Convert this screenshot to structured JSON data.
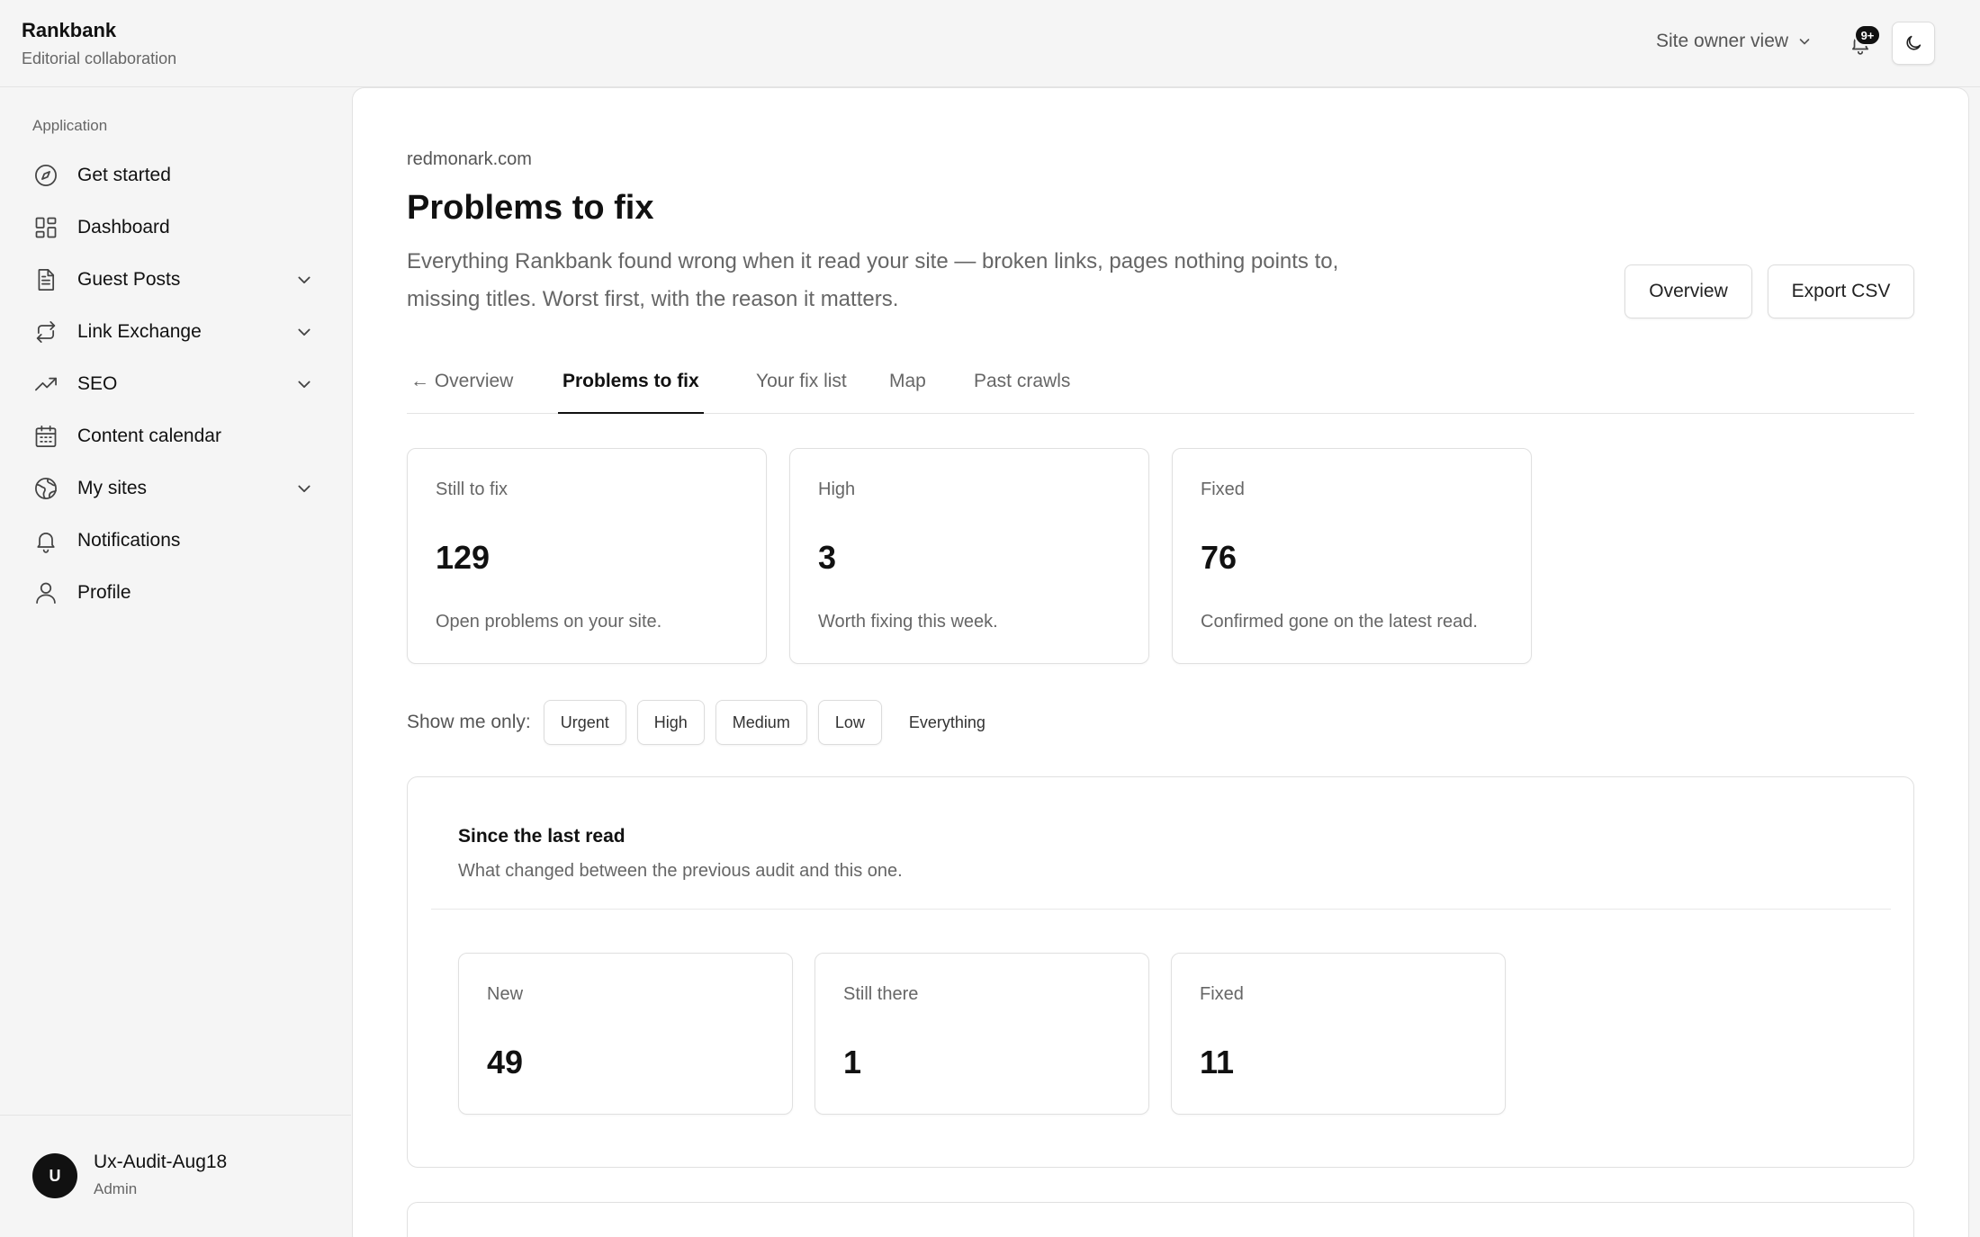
{
  "brand": {
    "name": "Rankbank",
    "subtitle": "Editorial collaboration"
  },
  "header": {
    "view_switch": "Site owner view",
    "notification_badge": "9+",
    "icons": {
      "view_switch": "chevron-down-icon",
      "notifications": "bell-icon",
      "theme": "moon-icon"
    }
  },
  "sidebar": {
    "group_label": "Application",
    "items": [
      {
        "label": "Get started",
        "icon": "compass-icon",
        "expandable": false
      },
      {
        "label": "Dashboard",
        "icon": "dashboard-icon",
        "expandable": false
      },
      {
        "label": "Guest Posts",
        "icon": "document-icon",
        "expandable": true
      },
      {
        "label": "Link Exchange",
        "icon": "exchange-icon",
        "expandable": true
      },
      {
        "label": "SEO",
        "icon": "trending-up-icon",
        "expandable": true
      },
      {
        "label": "Content calendar",
        "icon": "calendar-icon",
        "expandable": false
      },
      {
        "label": "My sites",
        "icon": "globe-icon",
        "expandable": true
      },
      {
        "label": "Notifications",
        "icon": "bell-icon",
        "expandable": false
      },
      {
        "label": "Profile",
        "icon": "user-icon",
        "expandable": false
      }
    ],
    "user": {
      "initial": "U",
      "name": "Ux-Audit-Aug18",
      "role": "Admin"
    }
  },
  "main": {
    "breadcrumb": "redmonark.com",
    "title": "Problems to fix",
    "description": "Everything Rankbank found wrong when it read your site — broken links, pages nothing points to, missing titles. Worst first, with the reason it matters.",
    "actions": {
      "overview": "Overview",
      "export": "Export CSV"
    },
    "tabs": [
      {
        "label": "← Overview",
        "active": false
      },
      {
        "label": "Problems to fix",
        "active": true
      },
      {
        "label": "Your fix list",
        "active": false
      },
      {
        "label": "Map",
        "active": false
      },
      {
        "label": "Past crawls",
        "active": false
      }
    ],
    "stats": [
      {
        "label": "Still to fix",
        "value": "129",
        "note": "Open problems on your site."
      },
      {
        "label": "High",
        "value": "3",
        "note": "Worth fixing this week."
      },
      {
        "label": "Fixed",
        "value": "76",
        "note": "Confirmed gone on the latest read."
      }
    ],
    "filters": {
      "label": "Show me only:",
      "options": [
        "Urgent",
        "High",
        "Medium",
        "Low",
        "Everything"
      ]
    },
    "since_last": {
      "title": "Since the last read",
      "subtitle": "What changed between the previous audit and this one.",
      "cards": [
        {
          "label": "New",
          "value": "49"
        },
        {
          "label": "Still there",
          "value": "1"
        },
        {
          "label": "Fixed",
          "value": "11"
        }
      ]
    }
  }
}
